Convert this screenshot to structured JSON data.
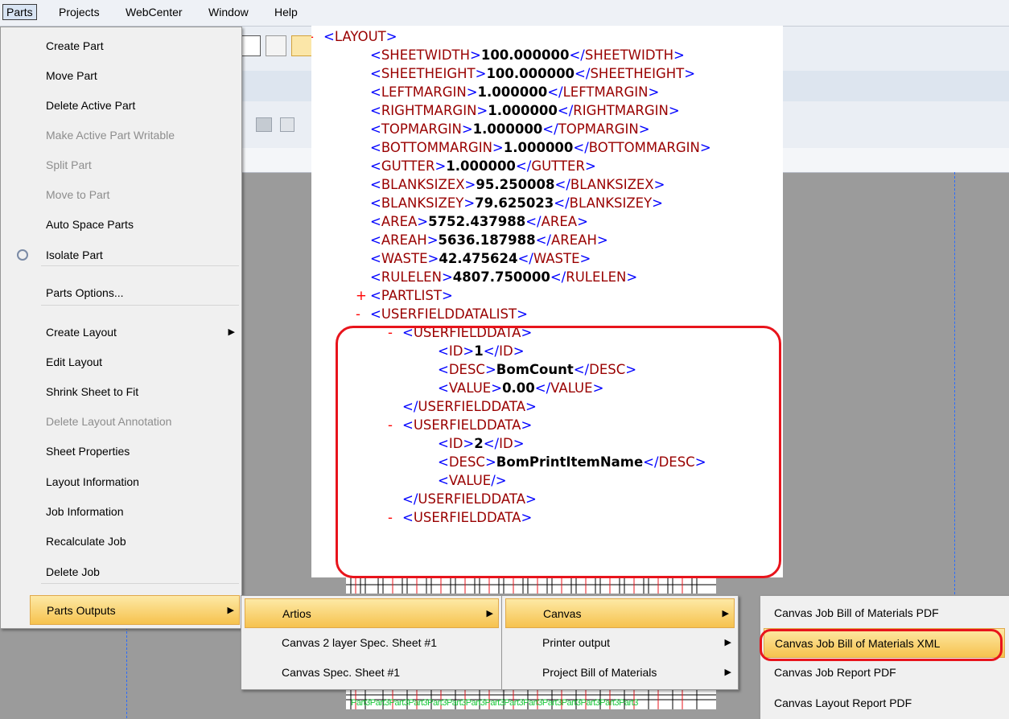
{
  "menubar": [
    "Parts",
    "Projects",
    "WebCenter",
    "Window",
    "Help"
  ],
  "parts_menu": [
    {
      "label": "Create Part",
      "disabled": false
    },
    {
      "label": "Move Part",
      "disabled": false
    },
    {
      "label": "Delete Active Part",
      "disabled": false
    },
    {
      "label": "Make Active Part Writable",
      "disabled": true
    },
    {
      "label": "Split Part",
      "disabled": true
    },
    {
      "label": "Move to Part",
      "disabled": true
    },
    {
      "label": "Auto Space Parts",
      "disabled": false
    },
    {
      "label": "Isolate Part",
      "disabled": false,
      "icon": "isolate-part-icon"
    },
    {
      "label": "Parts Options...",
      "disabled": false
    },
    {
      "label": "Create Layout",
      "disabled": false,
      "submenu": true
    },
    {
      "label": "Edit Layout",
      "disabled": false
    },
    {
      "label": "Shrink Sheet to Fit",
      "disabled": false
    },
    {
      "label": "Delete Layout Annotation",
      "disabled": true
    },
    {
      "label": "Sheet Properties",
      "disabled": false
    },
    {
      "label": "Layout Information",
      "disabled": false
    },
    {
      "label": "Job Information",
      "disabled": false
    },
    {
      "label": "Recalculate Job",
      "disabled": false
    },
    {
      "label": "Delete Job",
      "disabled": false
    },
    {
      "label": "Parts Outputs",
      "disabled": false,
      "submenu": true,
      "highlighted": true
    }
  ],
  "outputs_menu": [
    {
      "label": "Artios",
      "submenu": true,
      "highlighted": true
    },
    {
      "label": "Canvas 2 layer Spec. Sheet #1"
    },
    {
      "label": "Canvas Spec. Sheet #1"
    }
  ],
  "artios_menu": [
    {
      "label": "Canvas",
      "submenu": true,
      "highlighted": true
    },
    {
      "label": "Printer output",
      "submenu": true
    },
    {
      "label": "Project Bill of Materials",
      "submenu": true
    }
  ],
  "canvas_menu": [
    {
      "label": "Canvas Job Bill of Materials PDF"
    },
    {
      "label": "Canvas Job Bill of Materials XML",
      "highlighted": true
    },
    {
      "label": "Canvas Job Report PDF"
    },
    {
      "label": "Canvas Layout Report PDF"
    }
  ],
  "xml_lines": [
    {
      "pm": "-",
      "tag": "LAYOUT",
      "indent": 0
    },
    {
      "tag": "SHEETWIDTH",
      "value": "100.000000",
      "indent": 1
    },
    {
      "tag": "SHEETHEIGHT",
      "value": "100.000000",
      "indent": 1
    },
    {
      "tag": "LEFTMARGIN",
      "value": "1.000000",
      "indent": 1
    },
    {
      "tag": "RIGHTMARGIN",
      "value": "1.000000",
      "indent": 1
    },
    {
      "tag": "TOPMARGIN",
      "value": "1.000000",
      "indent": 1
    },
    {
      "tag": "BOTTOMMARGIN",
      "value": "1.000000",
      "indent": 1
    },
    {
      "tag": "GUTTER",
      "value": "1.000000",
      "indent": 1
    },
    {
      "tag": "BLANKSIZEX",
      "value": "95.250008",
      "indent": 1
    },
    {
      "tag": "BLANKSIZEY",
      "value": "79.625023",
      "indent": 1
    },
    {
      "tag": "AREA",
      "value": "5752.437988",
      "indent": 1
    },
    {
      "tag": "AREAH",
      "value": "5636.187988",
      "indent": 1
    },
    {
      "tag": "WASTE",
      "value": "42.475624",
      "indent": 1
    },
    {
      "tag": "RULELEN",
      "value": "4807.750000",
      "indent": 1
    },
    {
      "pm": "+",
      "tag": "PARTLIST",
      "indent": 1
    },
    {
      "pm": "-",
      "tag": "USERFIELDDATALIST",
      "indent": 1
    },
    {
      "pm": "-",
      "tag": "USERFIELDDATA",
      "indent": 2
    },
    {
      "tag": "ID",
      "value": "1",
      "indent": 3
    },
    {
      "tag": "DESC",
      "value": "BomCount",
      "indent": 3
    },
    {
      "tag": "VALUE",
      "value": "0.00",
      "indent": 3
    },
    {
      "close": "USERFIELDDATA",
      "indent": 2
    },
    {
      "pm": "-",
      "tag": "USERFIELDDATA",
      "indent": 2
    },
    {
      "tag": "ID",
      "value": "2",
      "indent": 3
    },
    {
      "tag": "DESC",
      "value": "BomPrintItemName",
      "indent": 3
    },
    {
      "selfclose": "VALUE",
      "indent": 3
    },
    {
      "close": "USERFIELDDATA",
      "indent": 2
    },
    {
      "pm": "-",
      "tag": "USERFIELDDATA",
      "indent": 2
    }
  ],
  "canvas_part_label": "Part 3",
  "colors": {
    "highlight_top": "#fde9a5",
    "highlight_bottom": "#f6c24e",
    "annotation_red": "#e8141c",
    "xml_bracket": "#0000ff",
    "xml_tag": "#990000"
  }
}
